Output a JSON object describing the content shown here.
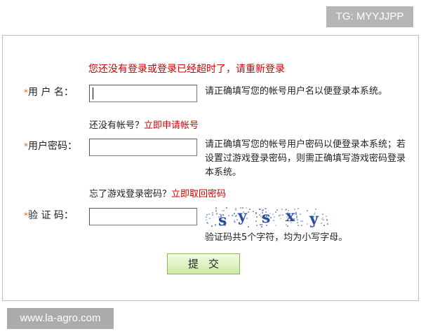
{
  "watermarks": {
    "top": "TG: MYYJJPP",
    "bottom": "www.la-agro.com"
  },
  "notice": "您还没有登录或登录已经超时了，请重新登录",
  "fields": {
    "username": {
      "star": "*",
      "label": "用 户 名：",
      "value": "",
      "hint": "请正确填写您的帐号用户名以便登录本系统。"
    },
    "password": {
      "star": "*",
      "label": "用户密码：",
      "value": "",
      "hint": "请正确填写您的帐号用户密码以便登录本系统；若设置过游戏登录密码，则需正确填写游戏密码登录本系统。"
    },
    "captcha": {
      "star": "*",
      "label": "验 证 码：",
      "value": "",
      "hint": "验证码共5个字符，均为小写字母。",
      "image_text": "sysxy"
    }
  },
  "no_account": {
    "prefix": "还没有帐号？",
    "link": "立即申请帐号"
  },
  "forgot_password": {
    "prefix": "忘了游戏登录密码？",
    "link": "立即取回密码"
  },
  "submit_label": "提交",
  "colors": {
    "link_red": "#cc0000",
    "star_orange": "#e06a10",
    "captcha_blue": "#2a4e9e",
    "button_green": "#cfe9a6"
  }
}
